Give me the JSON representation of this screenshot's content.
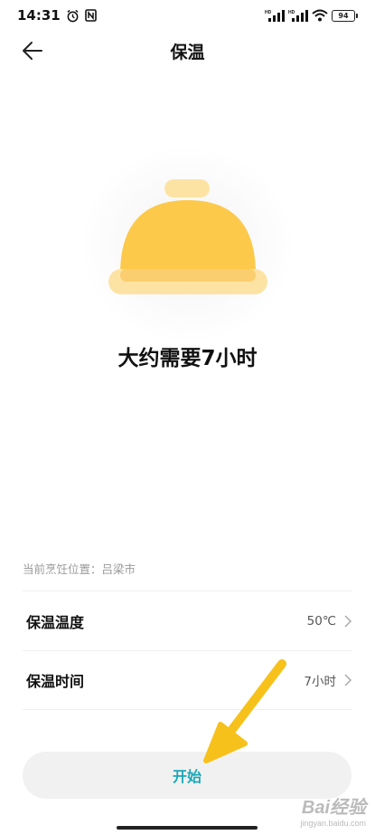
{
  "status_bar": {
    "time": "14:31",
    "signal1_label": "HD",
    "signal2_label": "HD",
    "battery": "94",
    "icons": [
      "alarm-icon",
      "nfc-icon",
      "signal-icon",
      "wifi-icon",
      "battery-icon"
    ]
  },
  "header": {
    "title": "保温",
    "back_icon": "arrow-left-icon"
  },
  "hero": {
    "icon": "food-cover-icon",
    "duration": "大约需要7小时",
    "colors": {
      "cover": "#fcc94a",
      "base": "#fde3a3",
      "handle": "#fde3a3"
    }
  },
  "location": {
    "label": "当前烹饪位置：吕梁市"
  },
  "settings": [
    {
      "label": "保温温度",
      "value": "50℃",
      "icon": "chevron-right-icon"
    },
    {
      "label": "保温时间",
      "value": "7小时",
      "icon": "chevron-right-icon"
    }
  ],
  "start_button": {
    "label": "开始",
    "color": "#1ba8b8"
  },
  "annotation": {
    "arrow_color": "#f7c11c"
  },
  "watermark": {
    "main": "Bai经验",
    "sub": "jingyan.baidu.com"
  }
}
